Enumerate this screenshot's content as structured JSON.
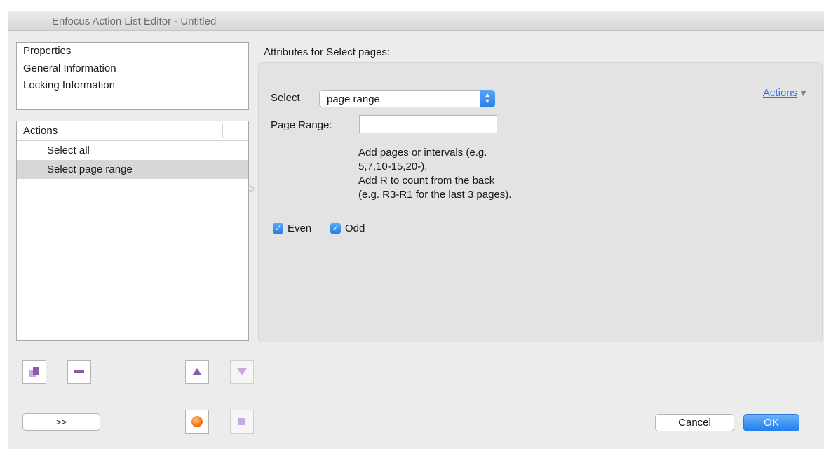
{
  "window": {
    "title": "Enfocus Action List Editor - Untitled"
  },
  "properties": {
    "header": "Properties",
    "items": [
      {
        "label": "General Information"
      },
      {
        "label": "Locking Information"
      }
    ]
  },
  "actions_list": {
    "header": "Actions",
    "items": [
      {
        "label": "Select all",
        "selected": false
      },
      {
        "label": "Select page range",
        "selected": true
      }
    ]
  },
  "attributes": {
    "heading": "Attributes for Select pages:",
    "select_label": "Select",
    "select_value": "page range",
    "actions_menu_label": "Actions",
    "page_range_label": "Page Range:",
    "page_range_value": "",
    "help_lines": [
      "Add pages or intervals (e.g.",
      "5,7,10-15,20-).",
      "Add R to count from the back",
      "(e.g. R3-R1 for the last 3 pages)."
    ],
    "even": {
      "label": "Even",
      "checked": true
    },
    "odd": {
      "label": "Odd",
      "checked": true
    }
  },
  "toolbar": {
    "duplicate_icon": "duplicate-icon",
    "remove_icon": "minus-icon",
    "move_up_icon": "triangle-up-icon",
    "move_down_icon": "triangle-down-icon",
    "record_icon": "record-icon",
    "stop_icon": "stop-icon",
    "expand_label": ">>"
  },
  "dialog": {
    "cancel_label": "Cancel",
    "ok_label": "OK"
  },
  "colors": {
    "accent": "#2a7ee8",
    "toolbar_icon": "#8b5aa8",
    "toolbar_icon_disabled": "#c9a9df",
    "record": "#f07a1a"
  }
}
